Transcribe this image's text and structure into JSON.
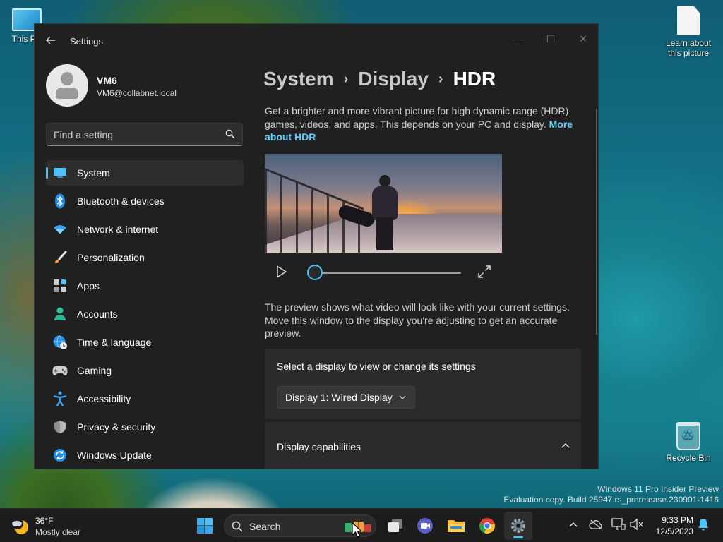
{
  "desktop": {
    "icons": [
      {
        "label": "This PC"
      },
      {
        "label": "Learn about this picture"
      },
      {
        "label": "Recycle Bin"
      }
    ],
    "watermark": {
      "line1": "Windows 11 Pro Insider Preview",
      "line2": "Evaluation copy. Build 25947.rs_prerelease.230901-1416"
    }
  },
  "window": {
    "title": "Settings",
    "controls": {
      "minimize": "—",
      "maximize": "☐",
      "close": "✕"
    }
  },
  "user": {
    "name": "VM6",
    "email": "VM6@collabnet.local"
  },
  "search": {
    "placeholder": "Find a setting"
  },
  "nav": {
    "items": [
      {
        "label": "System",
        "icon": "monitor-icon",
        "active": true
      },
      {
        "label": "Bluetooth & devices",
        "icon": "bluetooth-icon"
      },
      {
        "label": "Network & internet",
        "icon": "wifi-icon"
      },
      {
        "label": "Personalization",
        "icon": "brush-icon"
      },
      {
        "label": "Apps",
        "icon": "apps-icon"
      },
      {
        "label": "Accounts",
        "icon": "person-icon"
      },
      {
        "label": "Time & language",
        "icon": "globe-clock-icon"
      },
      {
        "label": "Gaming",
        "icon": "gamepad-icon"
      },
      {
        "label": "Accessibility",
        "icon": "accessibility-icon"
      },
      {
        "label": "Privacy & security",
        "icon": "shield-icon"
      },
      {
        "label": "Windows Update",
        "icon": "update-icon"
      }
    ]
  },
  "content": {
    "breadcrumb": [
      "System",
      "Display",
      "HDR"
    ],
    "description": "Get a brighter and more vibrant picture for high dynamic range (HDR) games, videos, and apps. This depends on your PC and display.",
    "more_link": "More about HDR",
    "preview_note": "The preview shows what video will look like with your current settings. Move this window to the display you're adjusting to get an accurate preview.",
    "media": {
      "progress": 0
    },
    "select_display": {
      "label": "Select a display to view or change its settings",
      "value": "Display 1: Wired Display"
    },
    "capabilities": {
      "label": "Display capabilities",
      "expanded": true
    }
  },
  "taskbar": {
    "weather": {
      "temp": "36°F",
      "condition": "Mostly clear"
    },
    "search_label": "Search",
    "apps": [
      "start-icon",
      "task-view-icon",
      "meet-icon",
      "file-explorer-icon",
      "chrome-icon",
      "settings-icon"
    ],
    "clock": {
      "time": "9:33 PM",
      "date": "12/5/2023"
    }
  },
  "colors": {
    "accent": "#4cc2ff",
    "link": "#60cdff",
    "window_bg": "#202020",
    "card_bg": "#2b2b2b",
    "taskbar_bg": "#1c1c1c"
  }
}
